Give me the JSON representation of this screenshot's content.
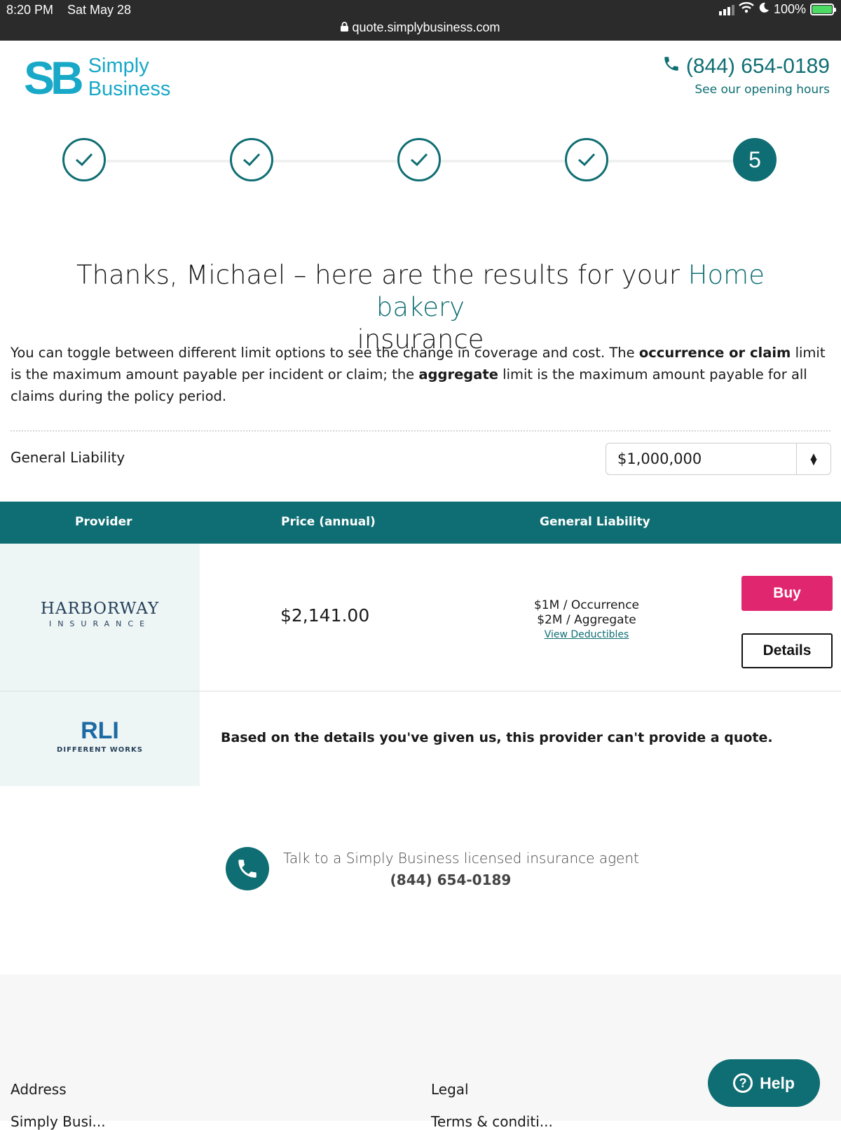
{
  "status": {
    "time": "8:20 PM",
    "date": "Sat May 28",
    "url": "quote.simplybusiness.com",
    "battery": "100%"
  },
  "brand": {
    "mark": "SB",
    "line1": "Simply",
    "line2": "Business"
  },
  "contact": {
    "phone": "(844) 654-0189",
    "hours_link": "See our opening hours"
  },
  "stepper": {
    "current_step": "5"
  },
  "headline": {
    "prefix": "Thanks, Michael – here are the results for your ",
    "business": "Home bakery",
    "suffix": "insurance"
  },
  "intro": {
    "p1": "You can toggle between different limit options to see the change in coverage and cost. The ",
    "b1": "occurrence or claim",
    "p2": " limit is the maximum amount payable per incident or claim; the ",
    "b2": "aggregate",
    "p3": " limit is the maximum amount payable for all claims during the policy period."
  },
  "limit": {
    "label": "General Liability",
    "selected": "$1,000,000"
  },
  "table": {
    "headers": [
      "Provider",
      "Price (annual)",
      "General Liability"
    ],
    "rows": [
      {
        "provider_name": "HARBORWAY",
        "provider_sub": "INSURANCE",
        "price": "$2,141.00",
        "occurrence": "$1M / Occurrence",
        "aggregate": "$2M / Aggregate",
        "deductibles_link": "View Deductibles",
        "buy": "Buy",
        "details": "Details"
      },
      {
        "provider_name": "RLI",
        "provider_sub": "DIFFERENT WORKS",
        "message": "Based on the details you've given us, this provider can't provide a quote."
      }
    ]
  },
  "agent": {
    "text": "Talk to a Simply Business licensed insurance agent",
    "phone": "(844) 654-0189"
  },
  "footer": {
    "address_heading": "Address",
    "legal_heading": "Legal",
    "address_cut": "Simply Busi...",
    "legal_cut": "Terms & conditi..."
  },
  "help": {
    "label": "Help"
  },
  "colors": {
    "teal": "#0f6e73",
    "brand_cyan": "#18a8c8",
    "buy_pink": "#e0266f"
  }
}
